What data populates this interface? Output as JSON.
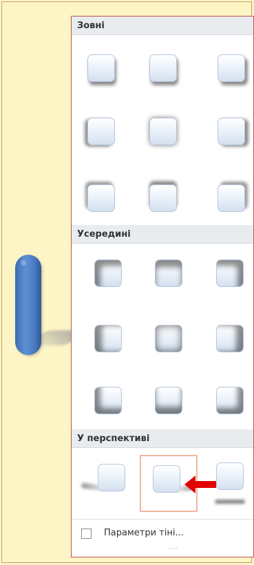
{
  "sections": {
    "outer": {
      "title": "Зовні"
    },
    "inner": {
      "title": "Усередині"
    },
    "perspective": {
      "title": "У перспективі"
    }
  },
  "footer": {
    "options_label": "Параметри тіні..."
  },
  "colors": {
    "accent": "#c0504d",
    "selection": "#f0b8a0",
    "arrow": "#e00000",
    "shape": "#4a79bf",
    "background": "#fdf5c6"
  }
}
